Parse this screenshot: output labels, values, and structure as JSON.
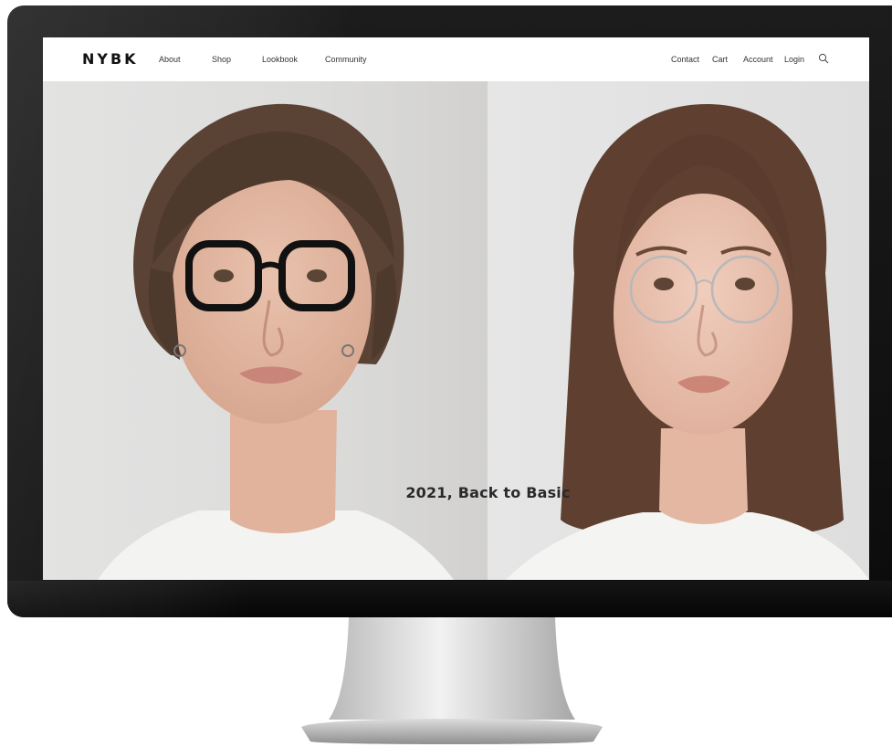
{
  "brand": {
    "logo_text": "NYBK"
  },
  "nav": {
    "left": [
      {
        "label": "About"
      },
      {
        "label": "Shop"
      },
      {
        "label": "Lookbook"
      },
      {
        "label": "Community"
      }
    ],
    "right": [
      {
        "label": "Contact"
      },
      {
        "label": "Cart"
      },
      {
        "label": "Account"
      },
      {
        "label": "Login"
      }
    ],
    "search_icon": "search-icon"
  },
  "hero": {
    "caption": "2021, Back to Basic",
    "left_photo": "person-black-frame-glasses",
    "right_photo": "person-silver-frame-glasses"
  },
  "colors": {
    "bezel": "#111111",
    "screen_bg": "#ffffff",
    "text": "#333333",
    "logo": "#111111"
  }
}
